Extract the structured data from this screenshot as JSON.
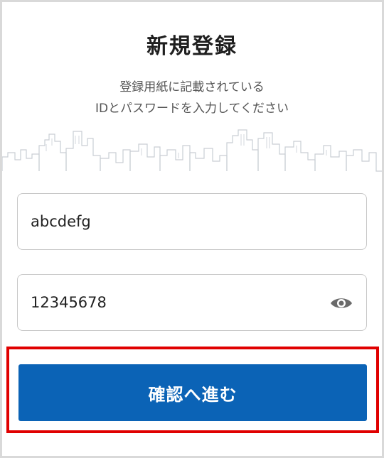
{
  "page": {
    "title": "新規登録",
    "subtitle_line1": "登録用紙に記載されている",
    "subtitle_line2": "IDとパスワードを入力してください"
  },
  "form": {
    "id_value": "abcdefg",
    "password_value": "12345678",
    "password_toggle_icon": "eye-icon",
    "submit_label": "確認へ進む"
  },
  "colors": {
    "primary_button": "#0b63b6",
    "highlight_border": "#e00000",
    "field_border": "#c8c8c8"
  }
}
